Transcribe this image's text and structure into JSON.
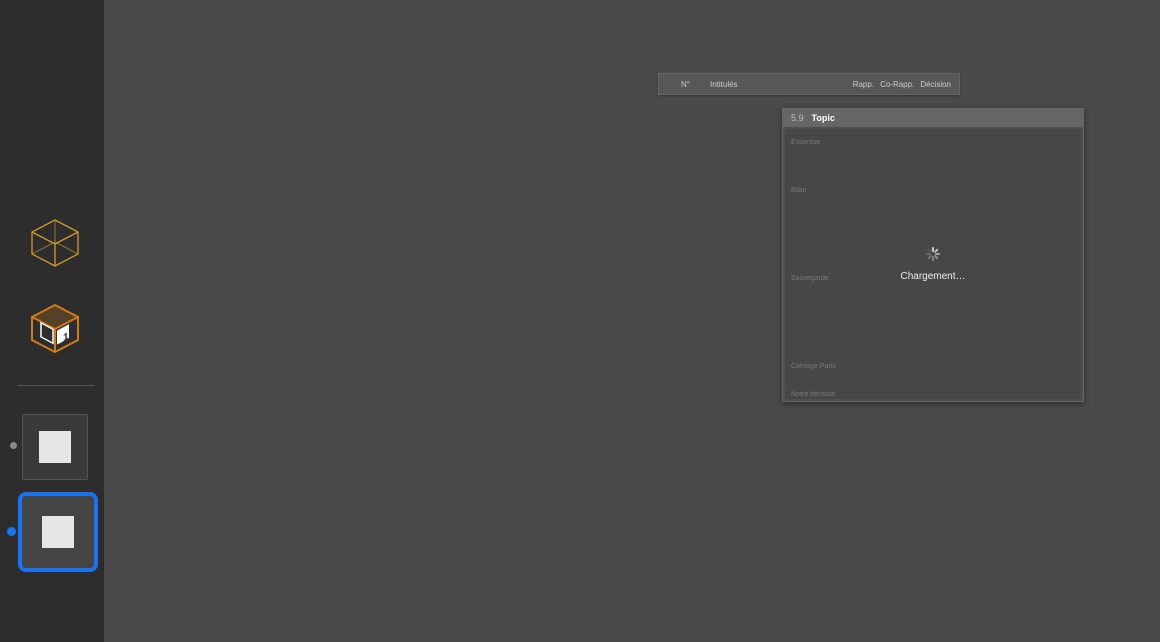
{
  "sidebar": {
    "icons": [
      "cube-wireframe",
      "cube-numbered"
    ],
    "slides": [
      {
        "selected": false
      },
      {
        "selected": true
      }
    ]
  },
  "mini_header": {
    "columns": [
      "N°",
      "Intitulés",
      "Rapp.",
      "Co-Rapp.",
      "Décision"
    ]
  },
  "panel": {
    "number": "5.9",
    "title": "Topic",
    "labels": [
      "Expertise",
      "Bilan",
      "Sauvegarde",
      "Carriage Paris",
      "Notre décision"
    ],
    "loading_text": "Chargement…"
  }
}
